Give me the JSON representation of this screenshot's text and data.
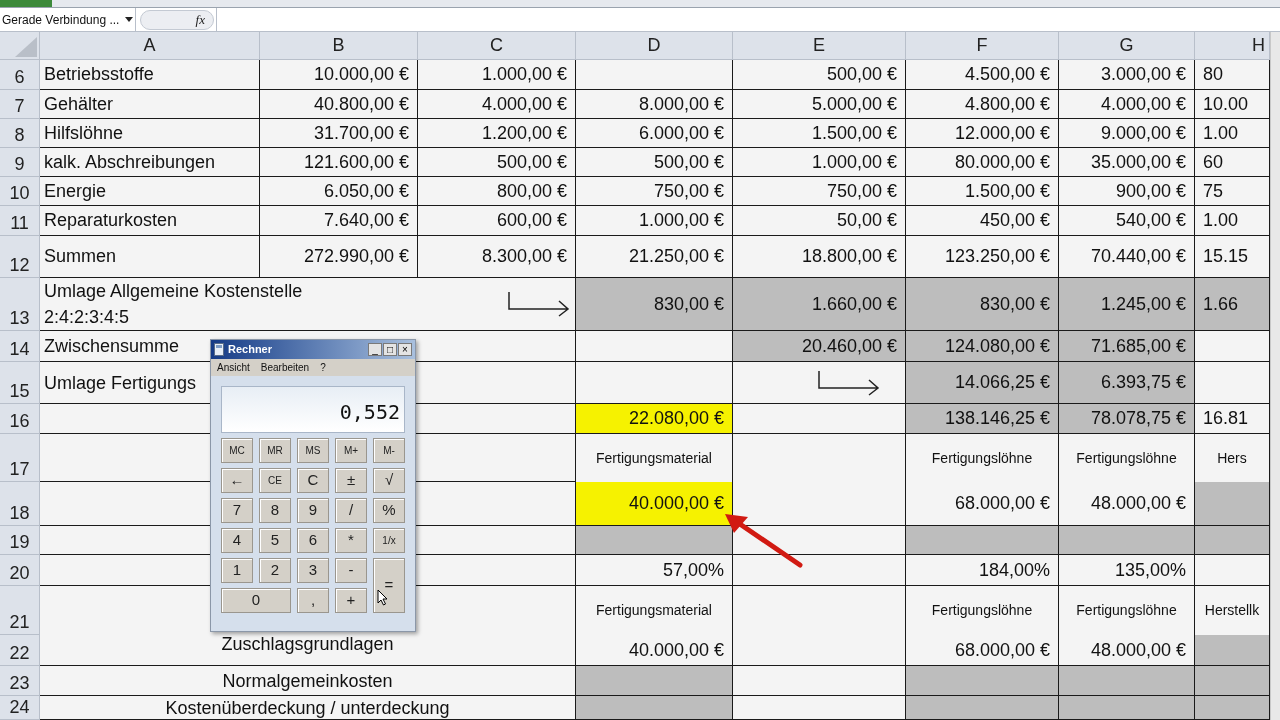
{
  "name_box": "Gerade Verbindung ...",
  "formula_symbol": "fx",
  "columns": [
    "A",
    "B",
    "C",
    "D",
    "E",
    "F",
    "G",
    "H"
  ],
  "upper_rows": [
    {
      "number": "6",
      "cells": [
        {
          "text": "Betriebsstoffe"
        },
        {
          "text": "10.000,00 €"
        },
        {
          "text": "1.000,00 €"
        },
        {},
        {
          "text": "500,00 €"
        },
        {
          "text": "4.500,00 €"
        },
        {
          "text": "3.000,00 €"
        },
        {
          "text": "80"
        }
      ]
    },
    {
      "number": "7",
      "cells": [
        {
          "text": "Gehälter"
        },
        {
          "text": "40.800,00 €"
        },
        {
          "text": "4.000,00 €"
        },
        {
          "text": "8.000,00 €"
        },
        {
          "text": "5.000,00 €"
        },
        {
          "text": "4.800,00 €"
        },
        {
          "text": "4.000,00 €"
        },
        {
          "text": "10.00"
        }
      ]
    },
    {
      "number": "8",
      "cells": [
        {
          "text": "Hilfslöhne"
        },
        {
          "text": "31.700,00 €"
        },
        {
          "text": "1.200,00 €"
        },
        {
          "text": "6.000,00 €"
        },
        {
          "text": "1.500,00 €"
        },
        {
          "text": "12.000,00 €"
        },
        {
          "text": "9.000,00 €"
        },
        {
          "text": "1.00"
        }
      ]
    },
    {
      "number": "9",
      "cells": [
        {
          "text": "kalk. Abschreibungen"
        },
        {
          "text": "121.600,00 €"
        },
        {
          "text": "500,00 €"
        },
        {
          "text": "500,00 €"
        },
        {
          "text": "1.000,00 €"
        },
        {
          "text": "80.000,00 €"
        },
        {
          "text": "35.000,00 €"
        },
        {
          "text": "60"
        }
      ]
    },
    {
      "number": "10",
      "cells": [
        {
          "text": "Energie"
        },
        {
          "text": "6.050,00 €"
        },
        {
          "text": "800,00 €"
        },
        {
          "text": "750,00 €"
        },
        {
          "text": "750,00 €"
        },
        {
          "text": "1.500,00 €"
        },
        {
          "text": "900,00 €"
        },
        {
          "text": "75"
        }
      ]
    },
    {
      "number": "11",
      "cells": [
        {
          "text": "Reparaturkosten"
        },
        {
          "text": "7.640,00 €"
        },
        {
          "text": "600,00 €"
        },
        {
          "text": "1.000,00 €"
        },
        {
          "text": "50,00 €"
        },
        {
          "text": "450,00 €"
        },
        {
          "text": "540,00 €"
        },
        {
          "text": "1.00"
        }
      ]
    },
    {
      "number": "12",
      "cells": [
        {
          "text": "Summen"
        },
        {
          "text": "272.990,00 €"
        },
        {
          "text": "8.300,00 €"
        },
        {
          "text": "21.250,00 €"
        },
        {
          "text": "18.800,00 €"
        },
        {
          "text": "123.250,00 €"
        },
        {
          "text": "70.440,00 €"
        },
        {
          "text": "15.15"
        }
      ]
    }
  ],
  "lower_rows": [
    {
      "number": "13",
      "label": {
        "lines": [
          "Umlage Allgemeine Kostenstelle",
          "2:4:2:3:4:5"
        ],
        "centered": false,
        "merged": false,
        "arrow": true
      },
      "cells": [
        {
          "text": "830,00 €",
          "color": "#bdbdbd",
          "kind": "value"
        },
        {
          "text": "1.660,00 €",
          "color": "#bdbdbd",
          "kind": "value"
        },
        {
          "text": "830,00 €",
          "color": "#bdbdbd",
          "kind": "value"
        },
        {
          "text": "1.245,00 €",
          "color": "#bdbdbd",
          "kind": "value"
        },
        {
          "text": "1.66",
          "color": "#bdbdbd",
          "kind": "value"
        }
      ]
    },
    {
      "number": "14",
      "label": {
        "lines": [
          "Zwischensumme"
        ],
        "centered": false,
        "merged": false,
        "arrow": false
      },
      "cells": [
        {
          "color": "#f4f4f4",
          "kind": "value"
        },
        {
          "text": "20.460,00 €",
          "color": "#bdbdbd",
          "kind": "value"
        },
        {
          "text": "124.080,00 €",
          "color": "#bdbdbd",
          "kind": "value"
        },
        {
          "text": "71.685,00 €",
          "color": "#bdbdbd",
          "kind": "value"
        },
        {
          "color": "#f4f4f4",
          "kind": "value"
        }
      ]
    },
    {
      "number": "15",
      "label": {
        "lines": [
          "Umlage Fertigungs"
        ],
        "centered": false,
        "merged": false,
        "arrow": false
      },
      "cells": [
        {
          "color": "#f4f4f4",
          "kind": "value"
        },
        {
          "color": "#f4f4f4",
          "kind": "value",
          "arrow": true
        },
        {
          "text": "14.066,25 €",
          "color": "#bdbdbd",
          "kind": "value"
        },
        {
          "text": "6.393,75 €",
          "color": "#bdbdbd",
          "kind": "value"
        },
        {
          "color": "#f4f4f4",
          "kind": "value"
        }
      ]
    },
    {
      "number": "16",
      "cells": [
        {
          "text": "22.080,00 €",
          "color": "#f6f200",
          "kind": "value"
        },
        {
          "color": "#f4f4f4",
          "kind": "value"
        },
        {
          "text": "138.146,25 €",
          "color": "#bdbdbd",
          "kind": "value"
        },
        {
          "text": "78.078,75 €",
          "color": "#bdbdbd",
          "kind": "value"
        },
        {
          "text": "16.81",
          "color": "#f4f4f4",
          "kind": "value"
        }
      ]
    },
    {
      "number": "17",
      "cells": [
        {
          "text": "Fertigungsmaterial",
          "color": "#f4f4f4",
          "kind": "caption"
        },
        {
          "color": "#f4f4f4",
          "kind": "caption"
        },
        {
          "text": "Fertigungslöhne",
          "color": "#f4f4f4",
          "kind": "caption"
        },
        {
          "text": "Fertigungslöhne",
          "color": "#f4f4f4",
          "kind": "caption"
        },
        {
          "text": "Hers",
          "color": "#f4f4f4",
          "kind": "caption"
        }
      ]
    },
    {
      "number": "18",
      "cells": [
        {
          "text": "40.000,00 €",
          "color": "#f6f200",
          "kind": "value"
        },
        {
          "color": "#f4f4f4",
          "kind": "value"
        },
        {
          "text": "68.000,00 €",
          "color": "#f4f4f4",
          "kind": "value"
        },
        {
          "text": "48.000,00 €",
          "color": "#f4f4f4",
          "kind": "value"
        },
        {
          "color": "#bdbdbd",
          "kind": "value"
        }
      ]
    },
    {
      "number": "19",
      "cells": [
        {
          "color": "#bdbdbd",
          "kind": "value"
        },
        {
          "color": "#f4f4f4",
          "kind": "value"
        },
        {
          "color": "#bdbdbd",
          "kind": "value"
        },
        {
          "color": "#bdbdbd",
          "kind": "value"
        },
        {
          "color": "#bdbdbd",
          "kind": "value"
        }
      ]
    },
    {
      "number": "20",
      "cells": [
        {
          "text": "57,00%",
          "color": "#f4f4f4",
          "kind": "value"
        },
        {
          "color": "#f4f4f4",
          "kind": "value"
        },
        {
          "text": "184,00%",
          "color": "#f4f4f4",
          "kind": "value"
        },
        {
          "text": "135,00%",
          "color": "#f4f4f4",
          "kind": "value"
        },
        {
          "color": "#f4f4f4",
          "kind": "value"
        }
      ]
    },
    {
      "number": "21",
      "label": {
        "lines": [
          "Zuschlagsgrundlagen"
        ],
        "centered": true,
        "merged": true,
        "arrow": false
      },
      "cells": [
        {
          "text": "Fertigungsmaterial",
          "color": "#f4f4f4",
          "kind": "caption"
        },
        {
          "color": "#f4f4f4",
          "kind": "caption"
        },
        {
          "text": "Fertigungslöhne",
          "color": "#f4f4f4",
          "kind": "caption"
        },
        {
          "text": "Fertigungslöhne",
          "color": "#f4f4f4",
          "kind": "caption"
        },
        {
          "text": "Herstellk",
          "color": "#f4f4f4",
          "kind": "caption"
        }
      ]
    },
    {
      "number": "22",
      "cells": [
        {
          "text": "40.000,00 €",
          "color": "#f4f4f4",
          "kind": "value"
        },
        {
          "color": "#f4f4f4",
          "kind": "value"
        },
        {
          "text": "68.000,00 €",
          "color": "#f4f4f4",
          "kind": "value"
        },
        {
          "text": "48.000,00 €",
          "color": "#f4f4f4",
          "kind": "value"
        },
        {
          "color": "#bdbdbd",
          "kind": "value"
        }
      ]
    },
    {
      "number": "23",
      "label": {
        "lines": [
          "Normalgemeinkosten"
        ],
        "centered": true,
        "merged": false,
        "arrow": false
      },
      "cells": [
        {
          "color": "#bdbdbd",
          "kind": "value"
        },
        {
          "color": "#f4f4f4",
          "kind": "value"
        },
        {
          "color": "#bdbdbd",
          "kind": "value"
        },
        {
          "color": "#bdbdbd",
          "kind": "value"
        },
        {
          "color": "#bdbdbd",
          "kind": "value"
        }
      ]
    },
    {
      "number": "24",
      "label": {
        "lines": [
          "Kostenüberdeckung / unterdeckung"
        ],
        "centered": true,
        "merged": false,
        "arrow": false
      },
      "cells": [
        {
          "color": "#bdbdbd",
          "kind": "value"
        },
        {
          "color": "#f4f4f4",
          "kind": "value"
        },
        {
          "color": "#bdbdbd",
          "kind": "value"
        },
        {
          "color": "#bdbdbd",
          "kind": "value"
        },
        {
          "color": "#bdbdbd",
          "kind": "value"
        }
      ]
    }
  ],
  "calculator": {
    "title": "Rechner",
    "window_buttons": [
      "_",
      "□",
      "×"
    ],
    "menu": [
      "Ansicht",
      "Bearbeiten",
      "?"
    ],
    "display": "0,552",
    "keys": [
      {
        "label": "MC",
        "kind": "normal"
      },
      {
        "label": "MR",
        "kind": "normal"
      },
      {
        "label": "MS",
        "kind": "normal"
      },
      {
        "label": "M+",
        "kind": "normal"
      },
      {
        "label": "M-",
        "kind": "normal"
      },
      {
        "label": "←",
        "kind": "normal"
      },
      {
        "label": "CE",
        "kind": "normal"
      },
      {
        "label": "C",
        "kind": "normal"
      },
      {
        "label": "±",
        "kind": "normal"
      },
      {
        "label": "√",
        "kind": "normal"
      },
      {
        "label": "7",
        "kind": "normal"
      },
      {
        "label": "8",
        "kind": "normal"
      },
      {
        "label": "9",
        "kind": "normal"
      },
      {
        "label": "/",
        "kind": "normal"
      },
      {
        "label": "%",
        "kind": "normal"
      },
      {
        "label": "4",
        "kind": "normal"
      },
      {
        "label": "5",
        "kind": "normal"
      },
      {
        "label": "6",
        "kind": "normal"
      },
      {
        "label": "*",
        "kind": "normal"
      },
      {
        "label": "1/x",
        "kind": "normal"
      },
      {
        "label": "1",
        "kind": "normal"
      },
      {
        "label": "2",
        "kind": "normal"
      },
      {
        "label": "3",
        "kind": "normal"
      },
      {
        "label": "-",
        "kind": "normal"
      },
      {
        "label": "=",
        "kind": "tall"
      },
      {
        "label": "0",
        "kind": "wide"
      },
      {
        "label": ",",
        "kind": "normal"
      },
      {
        "label": "+",
        "kind": "normal"
      }
    ]
  }
}
